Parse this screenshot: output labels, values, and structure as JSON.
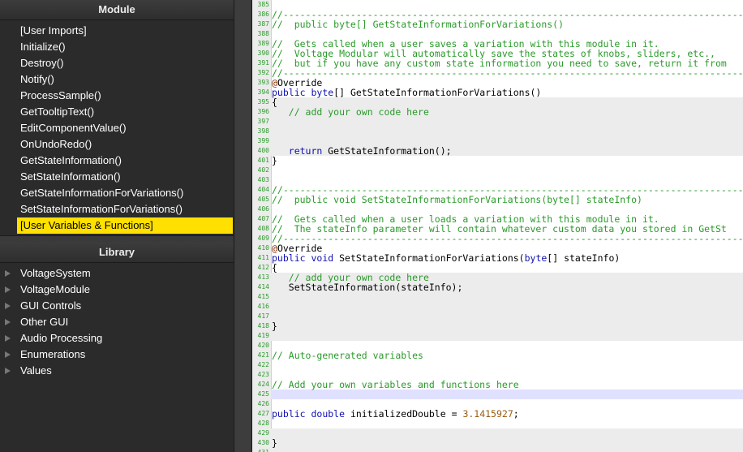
{
  "module_panel": {
    "title": "Module",
    "items": [
      "[User Imports]",
      "Initialize()",
      "Destroy()",
      "Notify()",
      "ProcessSample()",
      "GetTooltipText()",
      "EditComponentValue()",
      "OnUndoRedo()",
      "GetStateInformation()",
      "SetStateInformation()",
      "GetStateInformationForVariations()",
      "SetStateInformationForVariations()",
      "[User Variables & Functions]"
    ],
    "selected": "[User Variables & Functions]"
  },
  "library_panel": {
    "title": "Library",
    "items": [
      "VoltageSystem",
      "VoltageModule",
      "GUI Controls",
      "Other GUI",
      "Audio Processing",
      "Enumerations",
      "Values"
    ]
  },
  "editor": {
    "lines": [
      {
        "n": "385",
        "t": ""
      },
      {
        "n": "386",
        "t": "//-----------------------------------------------------------------------------------------"
      },
      {
        "n": "387",
        "t": "//  public byte[] GetStateInformationForVariations()"
      },
      {
        "n": "388",
        "t": ""
      },
      {
        "n": "389",
        "t": "//  Gets called when a user saves a variation with this module in it."
      },
      {
        "n": "390",
        "t": "//  Voltage Modular will automatically save the states of knobs, sliders, etc.,"
      },
      {
        "n": "391",
        "t": "//  but if you have any custom state information you need to save, return it from"
      },
      {
        "n": "392",
        "t": "//-----------------------------------------------------------------------------------------"
      },
      {
        "n": "393",
        "t": "@Override"
      },
      {
        "n": "394",
        "t": "public byte[] GetStateInformationForVariations()"
      },
      {
        "n": "395",
        "t": "{"
      },
      {
        "n": "396",
        "t": "   // add your own code here"
      },
      {
        "n": "397",
        "t": ""
      },
      {
        "n": "398",
        "t": ""
      },
      {
        "n": "399",
        "t": ""
      },
      {
        "n": "400",
        "t": "   return GetStateInformation();"
      },
      {
        "n": "401",
        "t": "}"
      },
      {
        "n": "402",
        "t": ""
      },
      {
        "n": "403",
        "t": ""
      },
      {
        "n": "404",
        "t": "//-----------------------------------------------------------------------------------------"
      },
      {
        "n": "405",
        "t": "//  public void SetStateInformationForVariations(byte[] stateInfo)"
      },
      {
        "n": "406",
        "t": ""
      },
      {
        "n": "407",
        "t": "//  Gets called when a user loads a variation with this module in it."
      },
      {
        "n": "408",
        "t": "//  The stateInfo parameter will contain whatever custom data you stored in GetSt"
      },
      {
        "n": "409",
        "t": "//-----------------------------------------------------------------------------------------"
      },
      {
        "n": "410",
        "t": "@Override"
      },
      {
        "n": "411",
        "t": "public void SetStateInformationForVariations(byte[] stateInfo)"
      },
      {
        "n": "412",
        "t": "{"
      },
      {
        "n": "413",
        "t": "   // add your own code here"
      },
      {
        "n": "414",
        "t": "   SetStateInformation(stateInfo);"
      },
      {
        "n": "415",
        "t": ""
      },
      {
        "n": "416",
        "t": ""
      },
      {
        "n": "417",
        "t": ""
      },
      {
        "n": "418",
        "t": "}"
      },
      {
        "n": "419",
        "t": ""
      },
      {
        "n": "420",
        "t": ""
      },
      {
        "n": "421",
        "t": "// Auto-generated variables"
      },
      {
        "n": "422",
        "t": ""
      },
      {
        "n": "423",
        "t": ""
      },
      {
        "n": "424",
        "t": "// Add your own variables and functions here"
      },
      {
        "n": "425",
        "t": ""
      },
      {
        "n": "426",
        "t": ""
      },
      {
        "n": "427",
        "t": "public double initializedDouble = 3.1415927;"
      },
      {
        "n": "428",
        "t": ""
      },
      {
        "n": "429",
        "t": ""
      },
      {
        "n": "430",
        "t": "}"
      },
      {
        "n": "431",
        "t": ""
      }
    ]
  },
  "colors": {
    "selected_bg": "#ffe000",
    "comment": "#2a9a2a",
    "keyword": "#1010b0",
    "annotation": "#7a2a00",
    "number": "#9a5a10",
    "line_numbers": "#2a9a2a",
    "shaded_block": "#ececec",
    "cursor_line": "#e0e0ff"
  }
}
